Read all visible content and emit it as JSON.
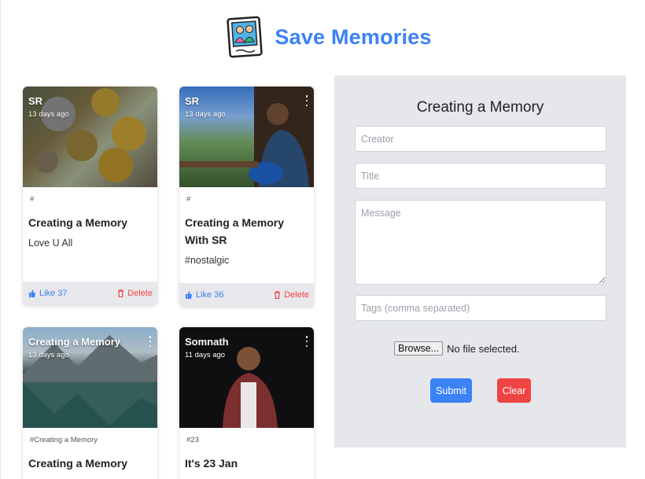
{
  "app": {
    "title": "Save Memories"
  },
  "cards": [
    {
      "creator": "SR",
      "time": "13 days ago",
      "tags": "#",
      "title": "Creating a Memory",
      "message": "Love U All",
      "like_label": "Like 37",
      "delete_label": "Delete"
    },
    {
      "creator": "SR",
      "time": "13 days ago",
      "tags": "#",
      "title": "Creating a Memory With SR",
      "message": "#nostalgic",
      "like_label": "Like 36",
      "delete_label": "Delete"
    },
    {
      "creator": "Creating a Memory",
      "time": "13 days ago",
      "tags": "#Creating a Memory",
      "title": "Creating a Memory",
      "message": "",
      "like_label": "",
      "delete_label": ""
    },
    {
      "creator": "Somnath",
      "time": "11 days ago",
      "tags": "#23",
      "title": "It's 23 Jan",
      "message": "",
      "like_label": "",
      "delete_label": ""
    }
  ],
  "form": {
    "title": "Creating a Memory",
    "creator_placeholder": "Creator",
    "title_placeholder": "Title",
    "message_placeholder": "Message",
    "tags_placeholder": "Tags (comma separated)",
    "browse_label": "Browse...",
    "file_status": "No file selected.",
    "submit_label": "Submit",
    "clear_label": "Clear"
  },
  "colors": {
    "accent": "#3b82f6",
    "danger": "#ef4444",
    "panel": "#e5e7eb"
  }
}
